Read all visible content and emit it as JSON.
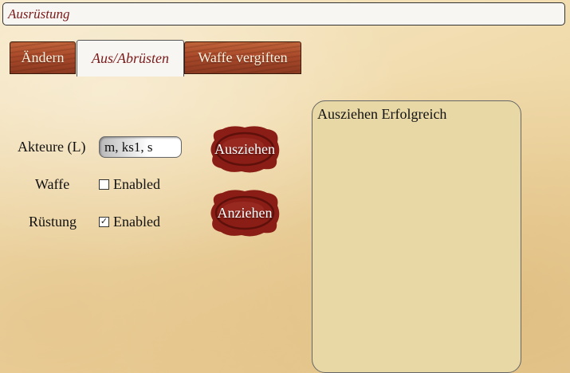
{
  "header": {
    "title": "Ausrüstung"
  },
  "tabs": [
    {
      "label": "Ändern",
      "active": false
    },
    {
      "label": "Aus/Abrüsten",
      "active": true
    },
    {
      "label": "Waffe vergiften",
      "active": false
    }
  ],
  "form": {
    "actors_label": "Akteure (L)",
    "actors_value": "m, ks1, s",
    "weapon_label": "Waffe",
    "weapon_checkbox": {
      "label": "Enabled",
      "checked": false,
      "mark": ""
    },
    "armor_label": "Rüstung",
    "armor_checkbox": {
      "label": "Enabled",
      "checked": true,
      "mark": "✓"
    }
  },
  "buttons": {
    "undress_label": "Ausziehen",
    "dress_label": "Anziehen"
  },
  "output": {
    "text": "Ausziehen Erfolgreich"
  },
  "colors": {
    "seal_red": "#8a1e16",
    "title_text": "#7a1a1a",
    "panel_bg": "#e8d8a6"
  }
}
